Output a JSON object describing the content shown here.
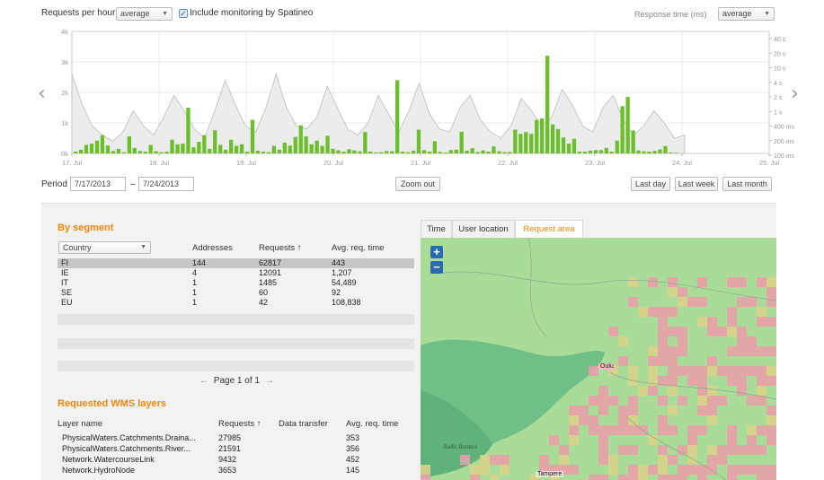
{
  "toolbar": {
    "requests_label": "Requests per hour",
    "requests_agg": "average",
    "monitoring_label": "Include monitoring by Spatineo",
    "response_label": "Response time (ms)",
    "response_agg": "average"
  },
  "colors": {
    "accent": "#f0860a",
    "bar": "#6bbf2a",
    "selected_row": "#c6c6c6"
  },
  "chart_data": {
    "type": "bar",
    "left_axis_ticks": [
      "4k",
      "3k",
      "2k",
      "1k",
      "0k"
    ],
    "right_axis_ticks": [
      "40 s",
      "20 s",
      "10 s",
      "4 s",
      "2 s",
      "1 s",
      "400 ms",
      "200 ms",
      "100 ms"
    ],
    "x_tick_labels": [
      "17. Jul",
      "18. Jul",
      "19. Jul",
      "20. Jul",
      "21. Jul",
      "22. Jul",
      "23. Jul",
      "24. Jul",
      "25. Jul"
    ],
    "ylim": [
      0,
      4000
    ],
    "series": [
      {
        "type": "bar",
        "values": [
          60,
          120,
          280,
          320,
          420,
          600,
          260,
          80,
          150,
          40,
          560,
          180,
          80,
          60,
          280,
          70,
          40,
          60,
          450,
          300,
          320,
          1500,
          200,
          380,
          600,
          150,
          760,
          280,
          120,
          450,
          250,
          300,
          60,
          1100,
          90,
          60,
          40,
          250,
          120,
          350,
          260,
          540,
          920,
          560,
          300,
          420,
          250,
          580,
          150,
          100,
          60,
          140,
          100,
          70,
          700,
          60,
          30,
          40,
          80,
          70,
          2400,
          60,
          40,
          90,
          780,
          110,
          60,
          400,
          50,
          30,
          110,
          120,
          710,
          90,
          170,
          50,
          100,
          60,
          230,
          70,
          40,
          50,
          780,
          640,
          700,
          640,
          1100,
          1150,
          3200,
          950,
          800,
          520,
          320,
          480,
          60,
          60,
          90,
          110,
          110,
          180,
          60,
          420,
          1550,
          1850,
          750,
          100,
          70,
          60,
          80,
          130,
          240,
          30,
          20
        ]
      },
      {
        "type": "area",
        "name": "Response time",
        "values": [
          2600,
          1600,
          900,
          600,
          400,
          700,
          1400,
          900,
          600,
          1200,
          1900,
          1400,
          800,
          500,
          1400,
          2400,
          1600,
          900,
          700,
          1500,
          2600,
          1500,
          900,
          800,
          1200,
          2200,
          1500,
          800,
          600,
          1000,
          1900,
          1300,
          700,
          1400,
          2300,
          1300,
          800,
          700,
          1500,
          1900,
          1100,
          700,
          500,
          900,
          1800,
          1400,
          900,
          1200,
          2100,
          1600,
          900,
          700,
          1500,
          1900,
          1100,
          600,
          900,
          1400,
          1000,
          500,
          600
        ]
      }
    ]
  },
  "period": {
    "label": "Period",
    "start": "7/17/2013",
    "separator": "–",
    "end": "7/24/2013",
    "zoom_out": "Zoom out",
    "last_day": "Last day",
    "last_week": "Last week",
    "last_month": "Last month"
  },
  "segment": {
    "title": "By segment",
    "dropdown": "Country",
    "headers": {
      "addresses": "Addresses",
      "requests": "Requests ↑",
      "avg": "Avg. req. time"
    },
    "rows": [
      {
        "code": "FI",
        "addresses": "144",
        "requests": "62817",
        "avg": "443"
      },
      {
        "code": "IE",
        "addresses": "4",
        "requests": "12091",
        "avg": "1,207"
      },
      {
        "code": "IT",
        "addresses": "1",
        "requests": "1485",
        "avg": "54,489"
      },
      {
        "code": "SE",
        "addresses": "1",
        "requests": "60",
        "avg": "92"
      },
      {
        "code": "EU",
        "addresses": "1",
        "requests": "42",
        "avg": "108,838"
      }
    ],
    "pager": {
      "prev": "←",
      "text": "Page 1 of 1",
      "next": "→"
    }
  },
  "layers": {
    "title": "Requested WMS layers",
    "headers": {
      "name": "Layer name",
      "requests": "Requests ↑",
      "transfer": "Data transfer",
      "avg": "Avg. req. time"
    },
    "rows": [
      {
        "name": "PhysicalWaters.Catchments.Draina...",
        "requests": "27985",
        "transfer": "",
        "avg": "353"
      },
      {
        "name": "PhysicalWaters.Catchments.River...",
        "requests": "21591",
        "transfer": "",
        "avg": "356"
      },
      {
        "name": "Network.WatercourseLink",
        "requests": "9432",
        "transfer": "",
        "avg": "452"
      },
      {
        "name": "Network.HydroNode",
        "requests": "3653",
        "transfer": "",
        "avg": "145"
      }
    ]
  },
  "map_tabs": [
    {
      "label": "Time",
      "active": false
    },
    {
      "label": "User location",
      "active": false
    },
    {
      "label": "Request area",
      "active": true
    }
  ],
  "map": {
    "zoom_in": "+",
    "zoom_out": "−",
    "cities": {
      "oulu": "Oulu",
      "tampere": "Tampere",
      "west": "Baltic Borders"
    }
  }
}
